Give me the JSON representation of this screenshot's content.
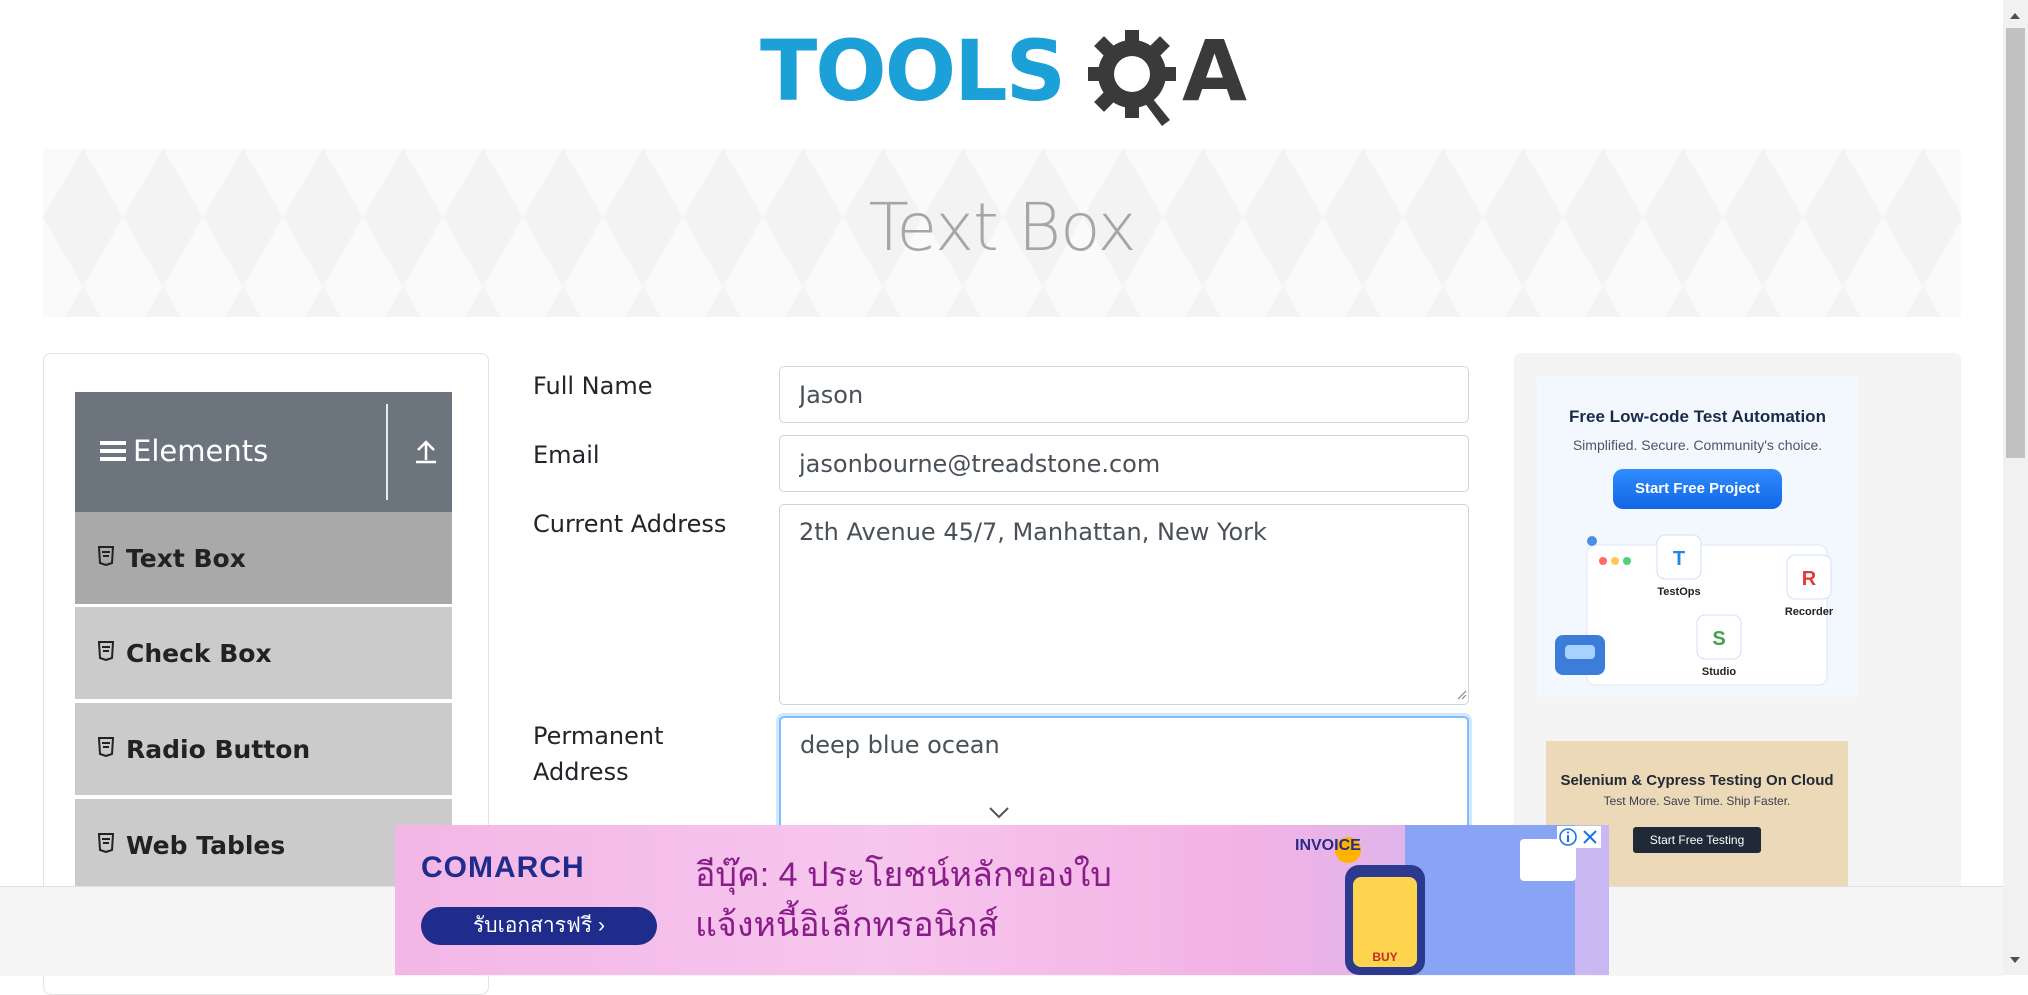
{
  "header": {
    "logo_text": "TOOLSQA"
  },
  "banner": {
    "title": "Text Box"
  },
  "sidebar": {
    "group_title": "Elements",
    "items": [
      {
        "label": "Text Box",
        "active": true
      },
      {
        "label": "Check Box",
        "active": false
      },
      {
        "label": "Radio Button",
        "active": false
      },
      {
        "label": "Web Tables",
        "active": false
      }
    ]
  },
  "form": {
    "full_name": {
      "label": "Full Name",
      "value": "Jason"
    },
    "email": {
      "label": "Email",
      "value": "jasonbourne@treadstone.com"
    },
    "current_address": {
      "label": "Current Address",
      "value": "2th Avenue 45/7, Manhattan, New York"
    },
    "permanent_address": {
      "label_line1": "Permanent",
      "label_line2": "Address",
      "value": "deep blue ocean"
    }
  },
  "ads": {
    "katalon": {
      "title": "Free Low-code Test Automation",
      "subtitle": "Simplified. Secure. Community's choice.",
      "button": "Start Free Project",
      "products": [
        "TestOps",
        "Recorder",
        "Studio"
      ]
    },
    "selenium": {
      "title": "Selenium & Cypress Testing On Cloud",
      "subtitle": "Test More. Save Time. Ship Faster.",
      "button": "Start Free Testing"
    },
    "bottom": {
      "brand": "COMARCH",
      "cta": "รับเอกสารฟรี ›",
      "headline1": "อีบุ๊ค: 4 ประโยชน์หลักของใบ",
      "headline2": "แจ้งหนี้อิเล็กทรอนิกส์",
      "art_label": "INVOICE",
      "cart_label": "BUY"
    }
  },
  "colors": {
    "logo_blue": "#1ba0d8",
    "logo_dark": "#3a3a3a",
    "group_header_bg": "#6c757d",
    "active_item_bg": "#a9a9a9",
    "item_bg": "#cbcbcb",
    "focus_border": "#80bdff"
  }
}
